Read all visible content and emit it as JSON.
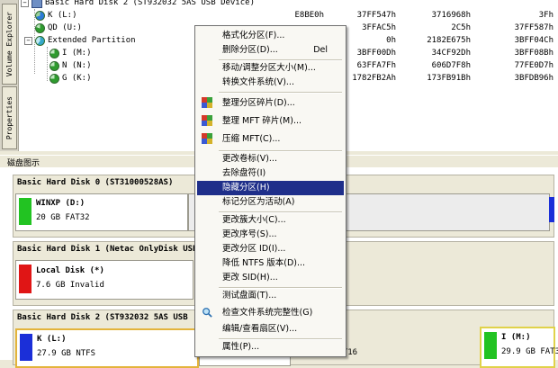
{
  "vtabs": [
    "Properties",
    "Volume Explorer"
  ],
  "tree": {
    "rows": [
      {
        "name": "Basic Hard Disk 2 (ST932032 5AS USB Device)",
        "c1": "",
        "c2": "",
        "c3": "",
        "c4": ""
      },
      {
        "name": "K (L:)",
        "c1": "E8BE0h",
        "c2": "37FF547h",
        "c3": "3716968h",
        "c4": "3Fh"
      },
      {
        "name": "QD (U:)",
        "c1": "",
        "c2": "3FFAC5h",
        "c3": "2C5h",
        "c4": "37FF587h"
      },
      {
        "name": "Extended Partition",
        "c1": "",
        "c2": "0h",
        "c3": "2182E675h",
        "c4": "3BFF04Ch"
      },
      {
        "name": "I (M:)",
        "c1": "",
        "c2": "3BFF00Dh",
        "c3": "34CF92Dh",
        "c4": "3BFF08Bh"
      },
      {
        "name": "N (N:)",
        "c1": "",
        "c2": "63FFA7Fh",
        "c3": "606D7F8h",
        "c4": "77FE0D7h"
      },
      {
        "name": "G (K:)",
        "c1": "",
        "c2": "1782FB2Ah",
        "c3": "173FB91Bh",
        "c4": "3BFDB96h"
      }
    ]
  },
  "diskmap": {
    "title": "磁盘图示",
    "disks": [
      {
        "title": "Basic Hard Disk 0 (ST31000528AS)",
        "partition_name": "WINXP (D:)",
        "partition_info": "20 GB FAT32",
        "color": "#22c322"
      },
      {
        "title": "Basic Hard Disk 1 (Netac OnlyDisk USB",
        "partition_name": "Local Disk (*)",
        "partition_info": "7.6 GB Invalid",
        "color": "#e01515"
      },
      {
        "title": "Basic Hard Disk 2 (ST932032 5AS USB",
        "partition_name": "K (L:)",
        "partition_info": "27.9 GB NTFS",
        "color": "#1b2fd8",
        "middle_info": "FAT16",
        "right_name": "I (M:)",
        "right_info": "29.9 GB FAT32"
      }
    ]
  },
  "menu": {
    "items": [
      {
        "label": "格式化分区(F)...",
        "shortcut": ""
      },
      {
        "label": "删除分区(D)...",
        "shortcut": "Del"
      },
      {
        "label": "移动/调整分区大小(M)...",
        "shortcut": ""
      },
      {
        "label": "转换文件系统(V)...",
        "shortcut": ""
      },
      {
        "label": "整理分区碎片(D)...",
        "shortcut": ""
      },
      {
        "label": "整理 MFT 碎片(M)...",
        "shortcut": ""
      },
      {
        "label": "压缩 MFT(C)...",
        "shortcut": ""
      },
      {
        "label": "更改卷标(V)...",
        "shortcut": ""
      },
      {
        "label": "去除盘符(I)",
        "shortcut": ""
      },
      {
        "label": "隐藏分区(H)",
        "shortcut": ""
      },
      {
        "label": "标记分区为活动(A)",
        "shortcut": ""
      },
      {
        "label": "更改簇大小(C)...",
        "shortcut": ""
      },
      {
        "label": "更改序号(S)...",
        "shortcut": ""
      },
      {
        "label": "更改分区 ID(I)...",
        "shortcut": ""
      },
      {
        "label": "降低 NTFS 版本(D)...",
        "shortcut": ""
      },
      {
        "label": "更改 SID(H)...",
        "shortcut": ""
      },
      {
        "label": "测试盘面(T)...",
        "shortcut": ""
      },
      {
        "label": "检查文件系统完整性(G)",
        "shortcut": ""
      },
      {
        "label": "编辑/查看扇区(V)...",
        "shortcut": ""
      },
      {
        "label": "属性(P)...",
        "shortcut": ""
      }
    ],
    "selected_index": 9
  }
}
